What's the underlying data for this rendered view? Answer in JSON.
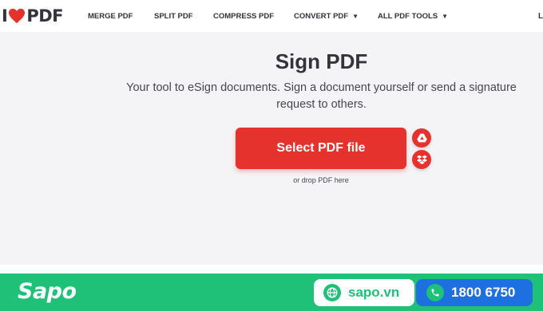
{
  "brand": {
    "logo_left": "I",
    "logo_right": "PDF",
    "accent": "#e5322d"
  },
  "nav": {
    "merge": "MERGE PDF",
    "split": "SPLIT PDF",
    "compress": "COMPRESS PDF",
    "convert": "CONVERT PDF",
    "all_tools": "ALL PDF TOOLS",
    "login": "L"
  },
  "main": {
    "title": "Sign PDF",
    "subtitle": "Your tool to eSign documents. Sign a document yourself or send a signature request to others.",
    "select_button": "Select PDF file",
    "drop_hint": "or drop PDF here",
    "cloud_buttons": [
      "google-drive-icon",
      "dropbox-icon"
    ]
  },
  "sapo": {
    "logo": "Sapo",
    "website": "sapo.vn",
    "phone": "1800 6750",
    "bar_color": "#1fc178",
    "phone_color": "#1e6fe0"
  }
}
